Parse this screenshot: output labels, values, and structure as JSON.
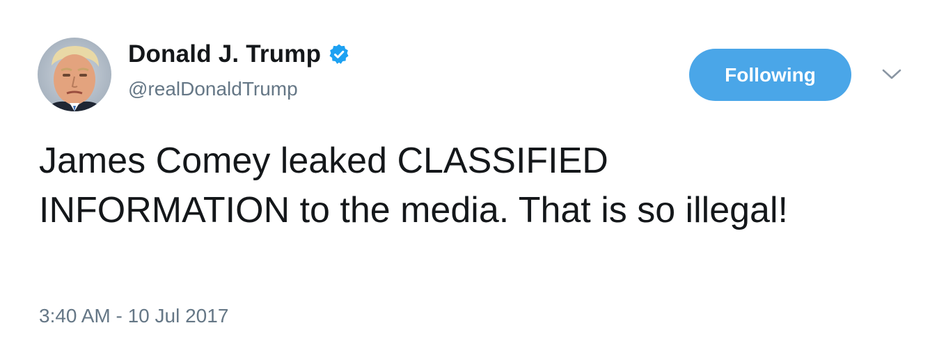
{
  "tweet": {
    "author": {
      "display_name": "Donald J. Trump",
      "handle": "@realDonaldTrump",
      "verified": true,
      "avatar_icon": "profile-photo"
    },
    "follow_button": {
      "label": "Following",
      "color": "#4aa6e8"
    },
    "menu_icon": "chevron-down-icon",
    "text": "James Comey leaked CLASSIFIED INFORMATION to the media. That is so illegal!",
    "timestamp": "3:40 AM - 10 Jul 2017"
  },
  "colors": {
    "text_primary": "#14171a",
    "text_secondary": "#657786",
    "verified_blue": "#1da1f2",
    "follow_blue": "#4aa6e8"
  }
}
